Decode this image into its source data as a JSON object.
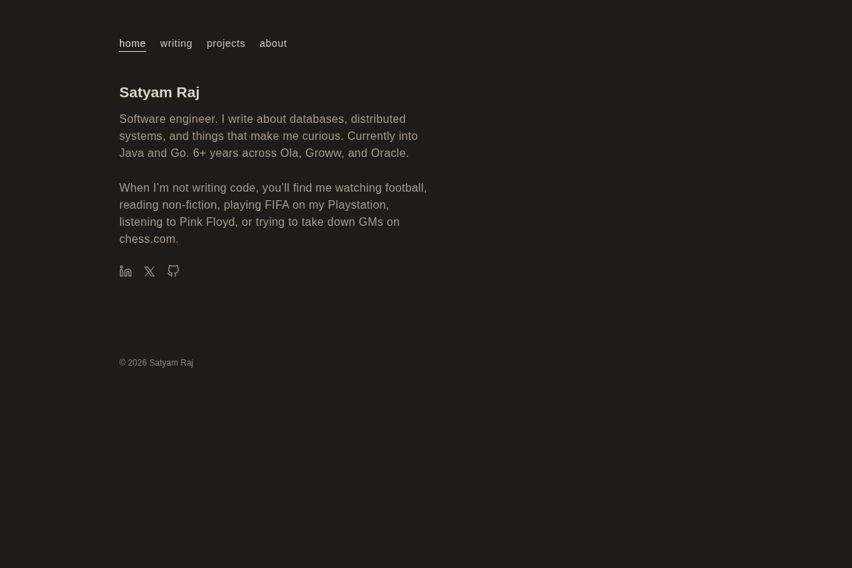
{
  "nav": [
    {
      "label": "home",
      "selected": true
    },
    {
      "label": "writing",
      "selected": false
    },
    {
      "label": "projects",
      "selected": false
    },
    {
      "label": "about",
      "selected": false
    }
  ],
  "intro": {
    "name": "Satyam Raj",
    "paragraphs": [
      "Software engineer. I write about databases, distributed systems, and things that make me curious. Currently into Java and Go. 6+ years across Ola, Groww, and Oracle.",
      "When I’m not writing code, you’ll find me watching football, reading non-fiction, playing FIFA on my Playstation, listening to Pink Floyd, or trying to take down GMs on chess.com."
    ]
  },
  "footer": {
    "text": "© 2026 Satyam Raj"
  }
}
